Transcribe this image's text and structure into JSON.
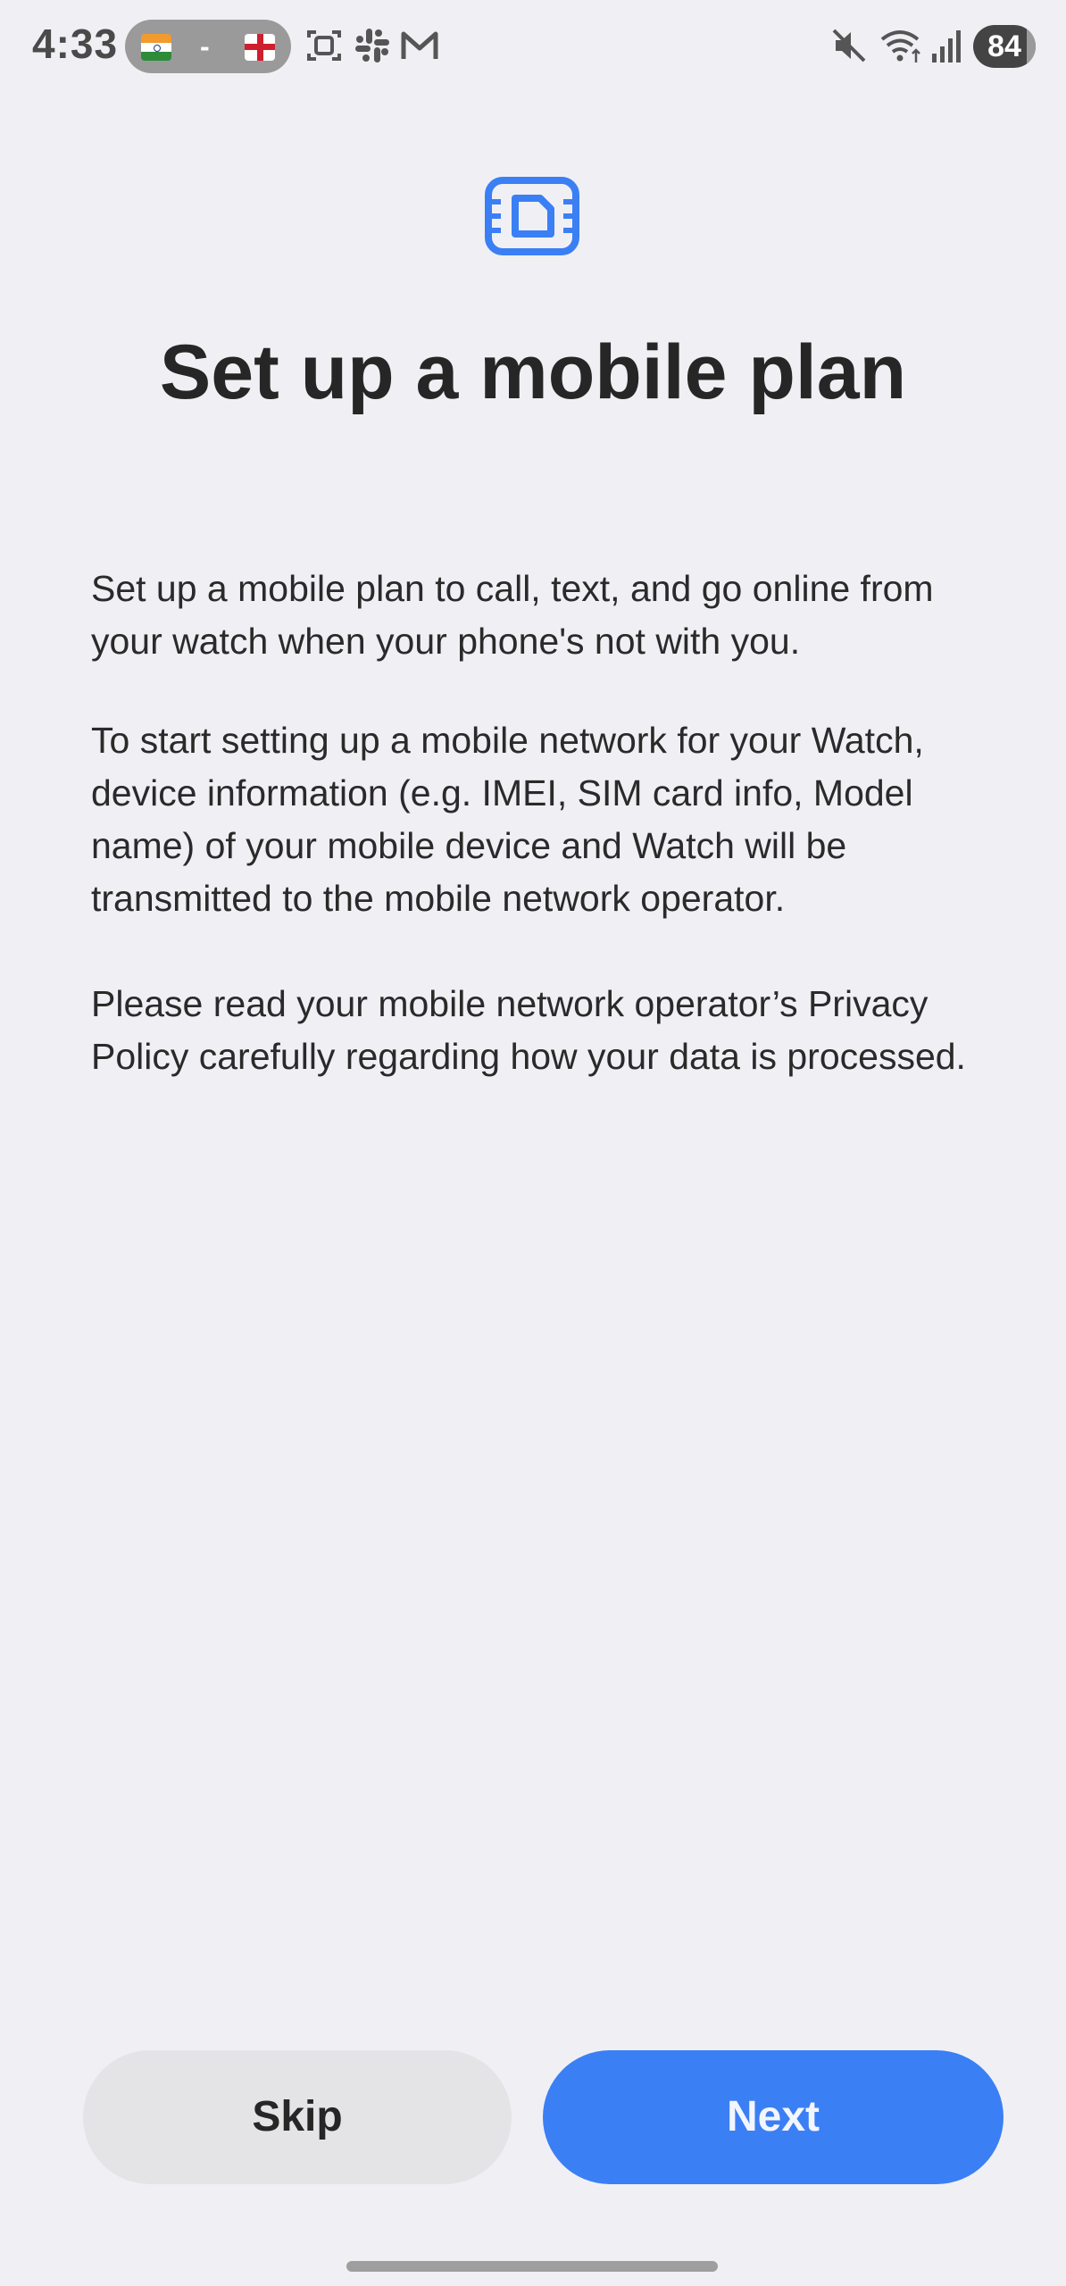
{
  "status_bar": {
    "time": "4:33",
    "flag_separator": "-",
    "battery": "84",
    "icons": [
      "india-flag-icon",
      "england-flag-icon",
      "screenshot-icon",
      "slack-icon",
      "gmail-icon",
      "mute-icon",
      "wifi-icon",
      "signal-icon",
      "battery-icon"
    ]
  },
  "header": {
    "icon": "sim-card-icon",
    "title": "Set up a mobile plan"
  },
  "body": {
    "paragraph_1": "Set up a mobile plan to call, text, and go online from your watch when your phone's not with you.",
    "paragraph_2": "To start setting up a mobile network for your Watch, device information (e.g. IMEI, SIM card info, Model name) of your mobile device and Watch will be transmitted to the mobile network operator.",
    "paragraph_3": "Please read your mobile network operator’s Privacy Policy carefully regarding how your data is processed."
  },
  "actions": {
    "skip_label": "Skip",
    "next_label": "Next"
  },
  "colors": {
    "accent": "#3b7ff5",
    "background": "#f0f0f4",
    "secondary_button": "#e4e4e7"
  }
}
